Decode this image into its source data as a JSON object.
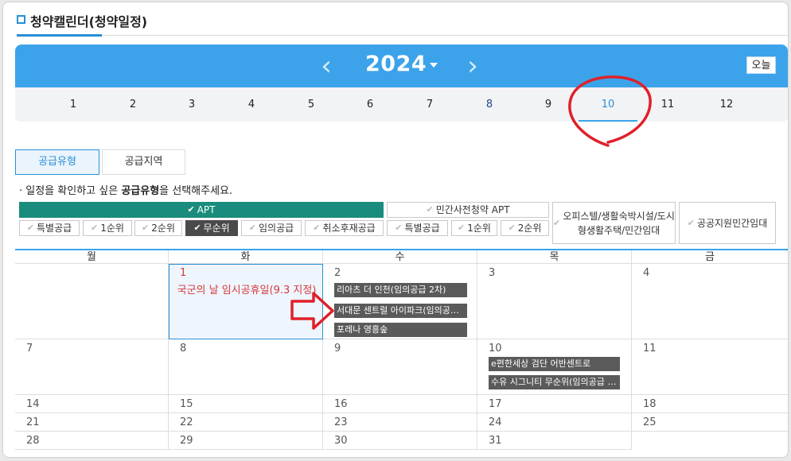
{
  "header": {
    "title": "청약캘린더(청약일정)"
  },
  "yearbar": {
    "year": "2024",
    "prev_icon": "chevron-left-icon",
    "next_icon": "chevron-right-icon",
    "today_label": "오늘"
  },
  "months": [
    "1",
    "2",
    "3",
    "4",
    "5",
    "6",
    "7",
    "8",
    "9",
    "10",
    "11",
    "12"
  ],
  "selected_month": "10",
  "tabs": {
    "type": "공급유형",
    "region": "공급지역"
  },
  "hint": {
    "prefix": "· 일정을 확인하고 싶은 ",
    "bold": "공급유형",
    "suffix": "을 선택해주세요."
  },
  "filters": {
    "apt": "APT",
    "private_apt": "민간사전청약 APT",
    "officetel": "오피스텔/생활숙박시설/도시형생활주택/민간임대",
    "public_rental": "공공지원민간임대",
    "apt_sub": [
      "특별공급",
      "1순위",
      "2순위",
      "무순위",
      "임의공급",
      "취소후재공급"
    ],
    "private_sub": [
      "특별공급",
      "1순위",
      "2순위"
    ]
  },
  "calendar": {
    "weekdays": [
      "월",
      "화",
      "수",
      "목",
      "금"
    ],
    "weeks": [
      [
        "",
        "1",
        "2",
        "3",
        "4"
      ],
      [
        "7",
        "8",
        "9",
        "10",
        "11"
      ],
      [
        "14",
        "15",
        "16",
        "17",
        "18"
      ],
      [
        "21",
        "22",
        "23",
        "24",
        "25"
      ],
      [
        "28",
        "29",
        "30",
        "31",
        ""
      ]
    ],
    "holiday_text": "국군의 날 임시공휴일(9.3 지정)",
    "events_2": [
      "리아츠 더 인천(임의공급 2차)",
      "서대문 센트럴 아이파크(임의공…",
      "포레나 영흥숲"
    ],
    "events_10": [
      "e편한세상 검단 어반센트로",
      "수유 시그니티 무순위(임의공급 …"
    ]
  },
  "colors": {
    "accent": "#3ca3ea",
    "teal": "#1a8c7d",
    "holiday": "#d63a3a",
    "annotation": "#e0202a"
  }
}
